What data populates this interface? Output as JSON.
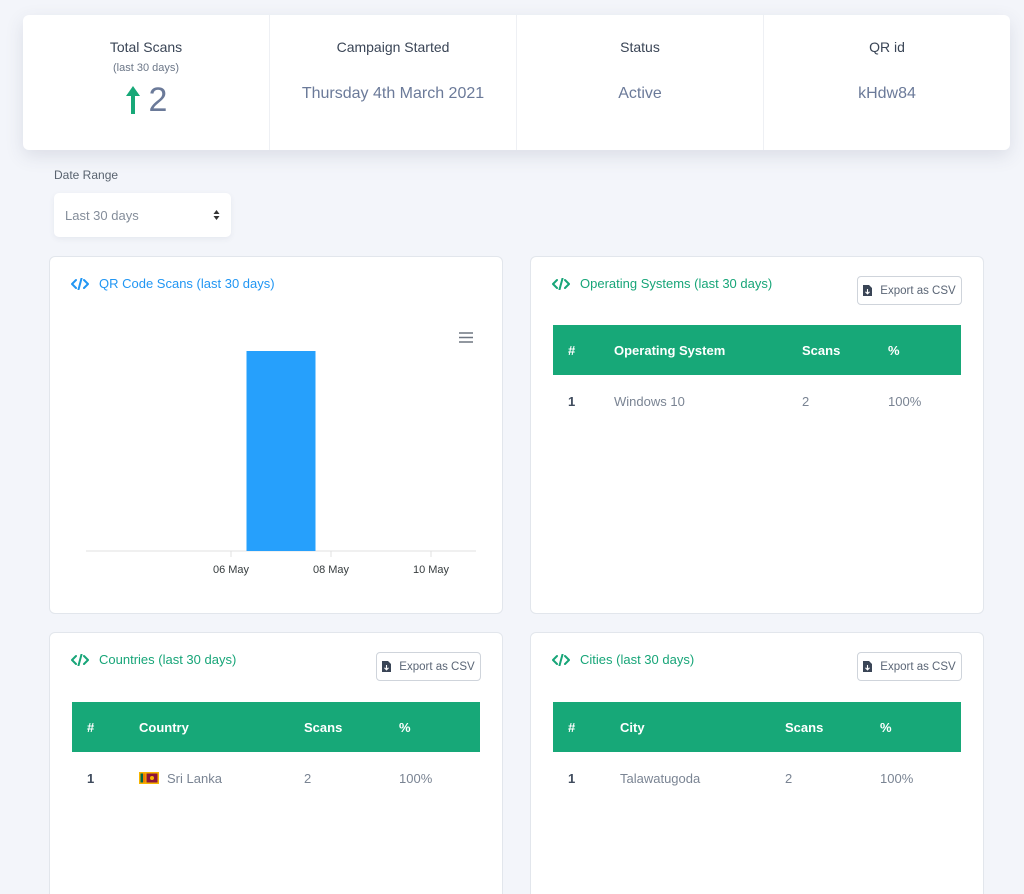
{
  "stats": {
    "total_scans": {
      "title": "Total Scans",
      "subtitle": "(last 30 days)",
      "value": "2"
    },
    "campaign_started": {
      "title": "Campaign Started",
      "value": "Thursday 4th March 2021"
    },
    "status": {
      "title": "Status",
      "value": "Active"
    },
    "qr_id": {
      "title": "QR id",
      "value": "kHdw84"
    }
  },
  "date_range": {
    "label": "Date Range",
    "selected": "Last 30 days"
  },
  "scans_card": {
    "title": "QR Code Scans (last 30 days)"
  },
  "os_card": {
    "title": "Operating Systems (last 30 days)",
    "export_label": "Export as CSV",
    "headers": [
      "#",
      "Operating System",
      "Scans",
      "%"
    ],
    "rows": [
      [
        "1",
        "Windows 10",
        "2",
        "100%"
      ]
    ]
  },
  "countries_card": {
    "title": "Countries (last 30 days)",
    "export_label": "Export as CSV",
    "headers": [
      "#",
      "Country",
      "Scans",
      "%"
    ],
    "rows": [
      [
        "1",
        "Sri Lanka",
        "2",
        "100%"
      ]
    ]
  },
  "cities_card": {
    "title": "Cities (last 30 days)",
    "export_label": "Export as CSV",
    "headers": [
      "#",
      "City",
      "Scans",
      "%"
    ],
    "rows": [
      [
        "1",
        "Talawatugoda",
        "2",
        "100%"
      ]
    ]
  },
  "icons": {
    "total": "arrow-up-icon",
    "card": "code-icon",
    "export": "file-download-icon",
    "select": "sort-caret-icon",
    "chart_menu": "hamburger-menu-icon",
    "country_flag": "sri-lanka-flag-icon"
  },
  "colors": {
    "accent_green": "#17a878",
    "accent_blue": "#2196f3",
    "bar_blue": "#26a0fc"
  },
  "chart_data": {
    "type": "bar",
    "x": [
      "06 May",
      "07 May",
      "08 May",
      "09 May",
      "10 May"
    ],
    "tick_labels": [
      "06 May",
      "08 May",
      "10 May"
    ],
    "values": [
      0,
      2,
      0,
      0,
      0
    ],
    "ylim": [
      0,
      2
    ],
    "grid": false,
    "legend": "none"
  }
}
